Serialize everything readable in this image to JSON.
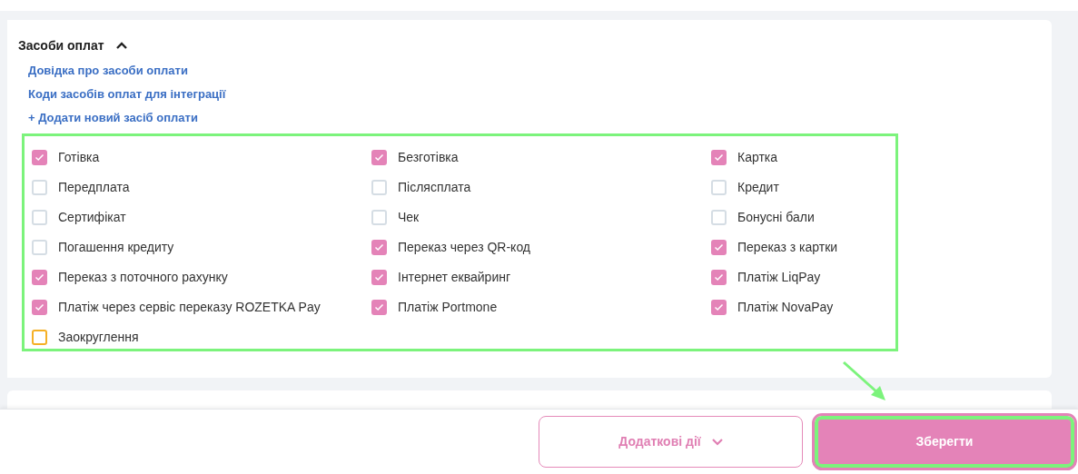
{
  "section": {
    "title": "Засоби оплат",
    "expanded": true
  },
  "links": [
    {
      "text": "Довідка про засоби оплати"
    },
    {
      "text": "Коди засобів оплат для інтеграції"
    },
    {
      "text": "+ Додати новий засіб оплати"
    }
  ],
  "payment_methods": [
    {
      "label": "Готівка",
      "checked": true,
      "kind": "normal"
    },
    {
      "label": "Безготівка",
      "checked": true,
      "kind": "normal"
    },
    {
      "label": "Картка",
      "checked": true,
      "kind": "normal"
    },
    {
      "label": "Передплата",
      "checked": false,
      "kind": "normal"
    },
    {
      "label": "Післясплата",
      "checked": false,
      "kind": "normal"
    },
    {
      "label": "Кредит",
      "checked": false,
      "kind": "normal"
    },
    {
      "label": "Сертифікат",
      "checked": false,
      "kind": "normal"
    },
    {
      "label": "Чек",
      "checked": false,
      "kind": "normal"
    },
    {
      "label": "Бонусні бали",
      "checked": false,
      "kind": "normal"
    },
    {
      "label": "Погашення кредиту",
      "checked": false,
      "kind": "normal"
    },
    {
      "label": "Переказ через QR-код",
      "checked": true,
      "kind": "normal"
    },
    {
      "label": "Переказ з картки",
      "checked": true,
      "kind": "normal"
    },
    {
      "label": "Переказ з поточного рахунку",
      "checked": true,
      "kind": "normal"
    },
    {
      "label": "Інтернет еквайринг",
      "checked": true,
      "kind": "normal"
    },
    {
      "label": "Платіж LiqPay",
      "checked": true,
      "kind": "normal"
    },
    {
      "label": "Платіж через сервіс переказу ROZETKA Pay",
      "checked": true,
      "kind": "normal"
    },
    {
      "label": "Платіж Portmone",
      "checked": true,
      "kind": "normal"
    },
    {
      "label": "Платіж NovaPay",
      "checked": true,
      "kind": "normal"
    },
    {
      "label": "Заокруглення",
      "checked": false,
      "kind": "accent"
    }
  ],
  "footer": {
    "secondary_button": "Додаткові дії",
    "primary_button": "Зберегти"
  }
}
